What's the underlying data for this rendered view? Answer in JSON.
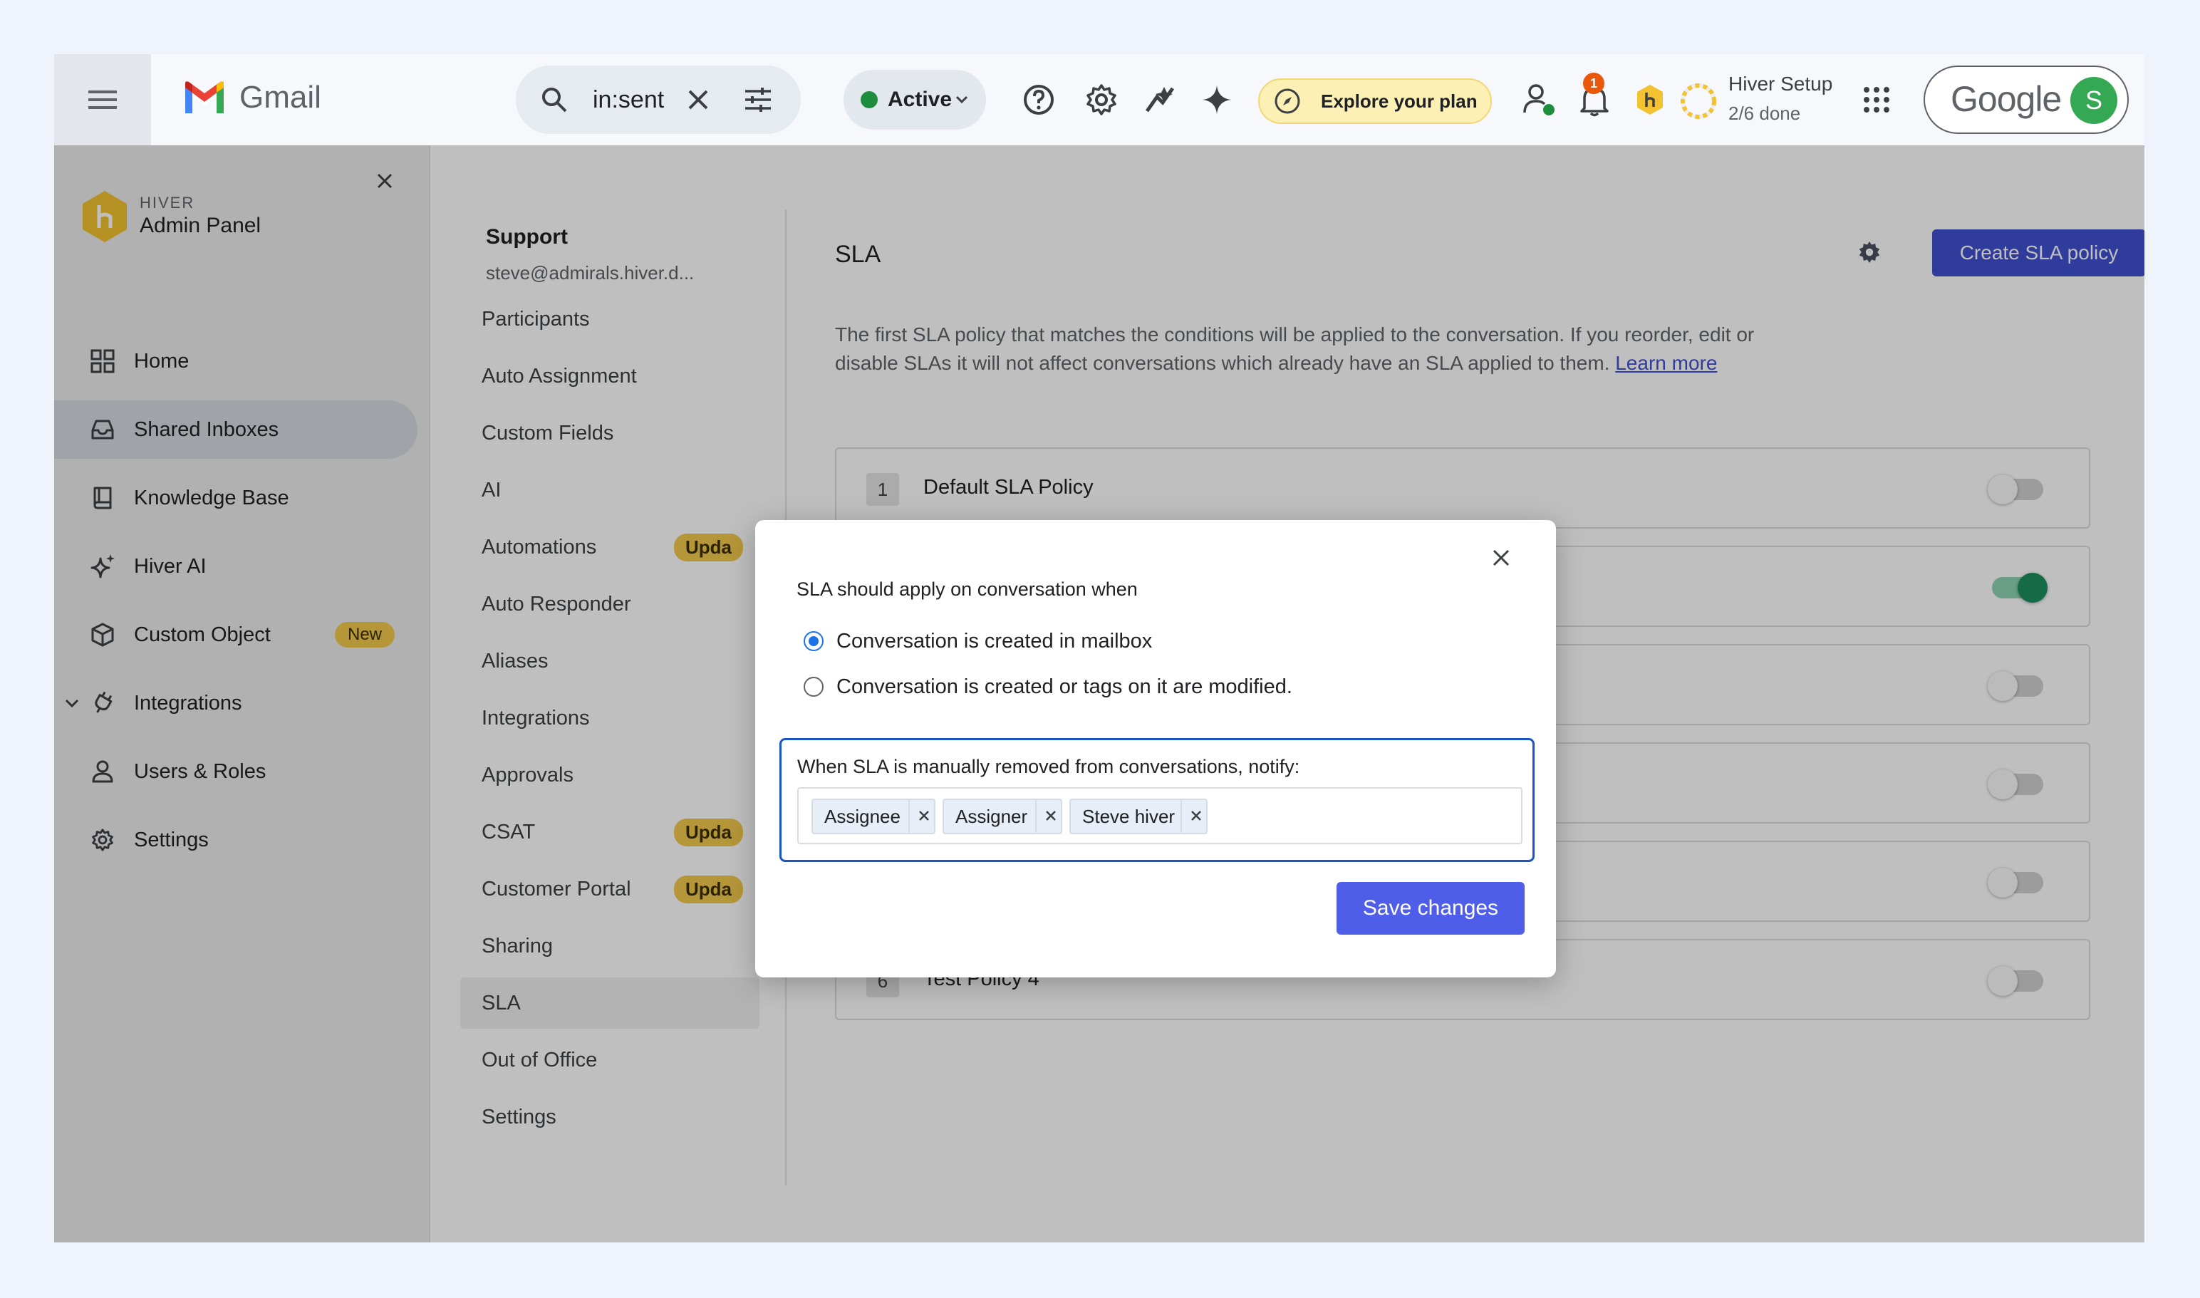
{
  "topbar": {
    "app_name": "Gmail",
    "search_query": "in:sent",
    "status_label": "Active",
    "explore_label": "Explore your plan",
    "notification_count": "1",
    "hiver_setup_title": "Hiver Setup",
    "hiver_setup_progress": "2/6 done",
    "google_wordmark": "Google",
    "avatar_initial": "S",
    "colors": {
      "status_dot": "#1e8e3e",
      "explore_bg": "#fdf0b4",
      "badge": "#ea580c",
      "avatar": "#34a853"
    }
  },
  "admin_panel": {
    "brand": "HIVER",
    "title": "Admin Panel",
    "nav": [
      {
        "label": "Home",
        "icon": "grid-icon"
      },
      {
        "label": "Shared Inboxes",
        "icon": "inbox-icon",
        "active": true
      },
      {
        "label": "Knowledge Base",
        "icon": "book-icon"
      },
      {
        "label": "Hiver AI",
        "icon": "sparkle-icon"
      },
      {
        "label": "Custom Object",
        "icon": "cube-icon",
        "badge": "New"
      },
      {
        "label": "Integrations",
        "icon": "plug-icon",
        "expandable": true
      },
      {
        "label": "Users & Roles",
        "icon": "user-icon"
      },
      {
        "label": "Settings",
        "icon": "gear-icon"
      }
    ]
  },
  "inbox_settings": {
    "inbox_name": "Support",
    "inbox_email": "steve@admirals.hiver.d...",
    "items": [
      {
        "label": "Participants"
      },
      {
        "label": "Auto Assignment"
      },
      {
        "label": "Custom Fields"
      },
      {
        "label": "AI"
      },
      {
        "label": "Automations",
        "badge": "Upda"
      },
      {
        "label": "Auto Responder"
      },
      {
        "label": "Aliases"
      },
      {
        "label": "Integrations"
      },
      {
        "label": "Approvals"
      },
      {
        "label": "CSAT",
        "badge": "Upda"
      },
      {
        "label": "Customer Portal",
        "badge": "Upda"
      },
      {
        "label": "Sharing"
      },
      {
        "label": "SLA",
        "active": true
      },
      {
        "label": "Out of Office"
      },
      {
        "label": "Settings"
      }
    ]
  },
  "sla": {
    "title": "SLA",
    "create_button": "Create SLA policy",
    "description": "The first SLA policy that matches the conditions will be applied to the conversation. If you reorder, edit or disable SLAs it will not affect conversations which already have an SLA applied to them.",
    "learn_more": "Learn more",
    "policies": [
      {
        "num": "1",
        "name": "Default SLA Policy",
        "enabled": false
      },
      {
        "num": "",
        "name": "",
        "enabled": true
      },
      {
        "num": "",
        "name": "",
        "enabled": false
      },
      {
        "num": "",
        "name": "",
        "enabled": false
      },
      {
        "num": "",
        "name": "",
        "enabled": false
      },
      {
        "num": "6",
        "name": "Test Policy 4",
        "enabled": false
      }
    ]
  },
  "modal": {
    "question": "SLA should apply on conversation when",
    "options": [
      {
        "label": "Conversation is created in mailbox",
        "checked": true
      },
      {
        "label": "Conversation is created or tags on it are modified.",
        "checked": false
      }
    ],
    "notify_label": "When SLA is manually removed from conversations, notify:",
    "chips": [
      "Assignee",
      "Assigner",
      "Steve hiver"
    ],
    "save_button": "Save changes"
  }
}
